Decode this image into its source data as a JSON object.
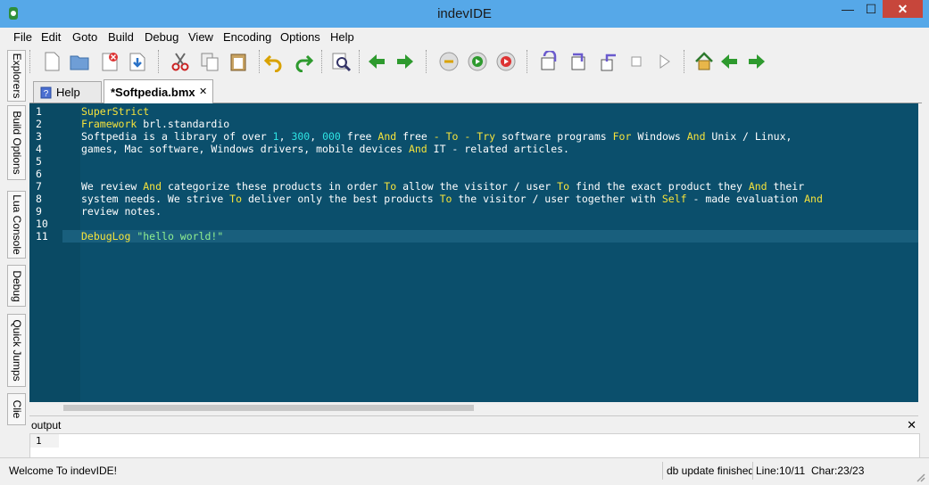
{
  "window": {
    "title": "indevIDE",
    "minimize": "—",
    "maximize": "☐",
    "close": "✕"
  },
  "menu": [
    "File",
    "Edit",
    "Goto",
    "Build",
    "Debug",
    "View",
    "Encoding",
    "Options",
    "Help"
  ],
  "side_tabs": [
    "Explorers",
    "Build Options",
    "Lua Console",
    "Debug",
    "Quick Jumps",
    "Clie"
  ],
  "toolbar_icons": [
    "new-file-icon",
    "open-folder-icon",
    "close-file-icon",
    "save-icon",
    "cut-icon",
    "copy-icon",
    "paste-icon",
    "undo-icon",
    "redo-icon",
    "find-icon",
    "back-icon",
    "forward-icon",
    "build-icon",
    "run-icon",
    "stop-icon",
    "step-icon",
    "step-into-icon",
    "step-out-icon",
    "pause-icon",
    "continue-icon",
    "home-icon",
    "nav-back-icon",
    "nav-forward-icon"
  ],
  "tabs": [
    {
      "label": "Help",
      "close": ""
    },
    {
      "label": "*Softpedia.bmx",
      "close": "✕"
    }
  ],
  "editor": {
    "line_numbers": [
      "1",
      "2",
      "3",
      "4",
      "5",
      "6",
      "7",
      "8",
      "9",
      "10",
      "11"
    ],
    "colors": {
      "background": "#0b4f6c",
      "keyword": "#f6e33b",
      "number": "#2ee3e3",
      "string": "#90ee90"
    }
  },
  "output": {
    "title": "output",
    "close": "✕",
    "line": "1"
  },
  "status": {
    "message": "Welcome To indevIDE!",
    "db": "db update finished",
    "line": "Line:10/11",
    "char": "Char:23/23"
  }
}
